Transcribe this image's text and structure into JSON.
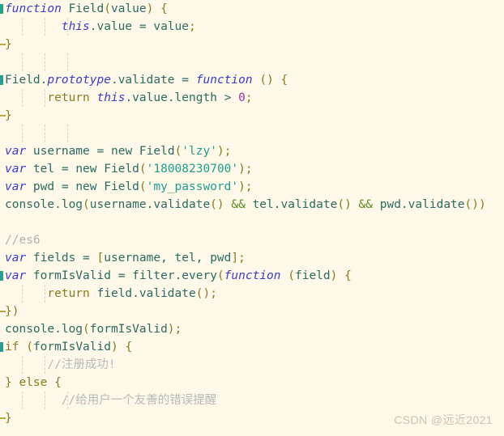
{
  "editor": {
    "background_color": "#fdf8e7",
    "language": "javascript",
    "colors": {
      "keyword": "#3b3bcd",
      "control": "#8a7a1e",
      "identifier": "#2b6b63",
      "string": "#1e9e8f",
      "number": "#9b30b0",
      "comment": "#b0b0b0",
      "punctuation": "#8a7a1e",
      "fold_marker": "#2a9d8f"
    }
  },
  "watermark": {
    "text": "CSDN @远近2021"
  },
  "code": {
    "lines": [
      {
        "id": "line-1",
        "fold": "start",
        "guides": [],
        "text": "function Field(value) {",
        "tokens": [
          {
            "t": "function",
            "c": "kw"
          },
          {
            "t": " ",
            "c": "plain"
          },
          {
            "t": "Field",
            "c": "ident"
          },
          {
            "t": "(",
            "c": "punc"
          },
          {
            "t": "value",
            "c": "ident"
          },
          {
            "t": ")",
            "c": "punc"
          },
          {
            "t": " ",
            "c": "plain"
          },
          {
            "t": "{",
            "c": "punc"
          }
        ]
      },
      {
        "id": "line-2",
        "fold": "none",
        "guides": [
          27,
          55,
          83
        ],
        "text": "        this.value = value;",
        "tokens": [
          {
            "t": "        ",
            "c": "plain"
          },
          {
            "t": "this",
            "c": "kw"
          },
          {
            "t": ".value ",
            "c": "ident"
          },
          {
            "t": "=",
            "c": "op"
          },
          {
            "t": " value",
            "c": "ident"
          },
          {
            "t": ";",
            "c": "punc"
          }
        ]
      },
      {
        "id": "line-3",
        "fold": "end",
        "guides": [],
        "text": "}",
        "tokens": [
          {
            "t": "}",
            "c": "punc"
          }
        ]
      },
      {
        "id": "line-4",
        "fold": "none",
        "guides": [
          27,
          55,
          83
        ],
        "text": "",
        "tokens": []
      },
      {
        "id": "line-5",
        "fold": "start",
        "guides": [],
        "text": "Field.prototype.validate = function () {",
        "tokens": [
          {
            "t": "Field",
            "c": "ident"
          },
          {
            "t": ".",
            "c": "plain"
          },
          {
            "t": "prototype",
            "c": "kw"
          },
          {
            "t": ".validate ",
            "c": "ident"
          },
          {
            "t": "=",
            "c": "op"
          },
          {
            "t": " ",
            "c": "plain"
          },
          {
            "t": "function",
            "c": "kw"
          },
          {
            "t": " ",
            "c": "plain"
          },
          {
            "t": "(",
            "c": "punc"
          },
          {
            "t": ")",
            "c": "punc"
          },
          {
            "t": " ",
            "c": "plain"
          },
          {
            "t": "{",
            "c": "punc"
          }
        ]
      },
      {
        "id": "line-6",
        "fold": "none",
        "guides": [
          27,
          55
        ],
        "text": "      return this.value.length > 0;",
        "tokens": [
          {
            "t": "      ",
            "c": "plain"
          },
          {
            "t": "return",
            "c": "ctrl"
          },
          {
            "t": " ",
            "c": "plain"
          },
          {
            "t": "this",
            "c": "kw"
          },
          {
            "t": ".value.length ",
            "c": "ident"
          },
          {
            "t": ">",
            "c": "op"
          },
          {
            "t": " ",
            "c": "plain"
          },
          {
            "t": "0",
            "c": "num"
          },
          {
            "t": ";",
            "c": "punc"
          }
        ]
      },
      {
        "id": "line-7",
        "fold": "end",
        "guides": [],
        "text": "}",
        "tokens": [
          {
            "t": "}",
            "c": "punc"
          }
        ]
      },
      {
        "id": "line-8",
        "fold": "none",
        "guides": [
          27,
          55,
          83
        ],
        "text": "",
        "tokens": []
      },
      {
        "id": "line-9",
        "fold": "none",
        "guides": [],
        "text": "var username = new Field('lzy');",
        "tokens": [
          {
            "t": "var",
            "c": "kw"
          },
          {
            "t": " username ",
            "c": "ident"
          },
          {
            "t": "=",
            "c": "op"
          },
          {
            "t": " new ",
            "c": "ident"
          },
          {
            "t": "Field",
            "c": "ident"
          },
          {
            "t": "(",
            "c": "punc"
          },
          {
            "t": "'lzy'",
            "c": "str"
          },
          {
            "t": ")",
            "c": "punc"
          },
          {
            "t": ";",
            "c": "punc"
          }
        ]
      },
      {
        "id": "line-10",
        "fold": "none",
        "guides": [],
        "text": "var tel = new Field('18008230700');",
        "tokens": [
          {
            "t": "var",
            "c": "kw"
          },
          {
            "t": " tel ",
            "c": "ident"
          },
          {
            "t": "=",
            "c": "op"
          },
          {
            "t": " new ",
            "c": "ident"
          },
          {
            "t": "Field",
            "c": "ident"
          },
          {
            "t": "(",
            "c": "punc"
          },
          {
            "t": "'18008230700'",
            "c": "str"
          },
          {
            "t": ")",
            "c": "punc"
          },
          {
            "t": ";",
            "c": "punc"
          }
        ]
      },
      {
        "id": "line-11",
        "fold": "none",
        "guides": [],
        "text": "var pwd = new Field('my_password');",
        "tokens": [
          {
            "t": "var",
            "c": "kw"
          },
          {
            "t": " pwd ",
            "c": "ident"
          },
          {
            "t": "=",
            "c": "op"
          },
          {
            "t": " new ",
            "c": "ident"
          },
          {
            "t": "Field",
            "c": "ident"
          },
          {
            "t": "(",
            "c": "punc"
          },
          {
            "t": "'my_password'",
            "c": "str"
          },
          {
            "t": ")",
            "c": "punc"
          },
          {
            "t": ";",
            "c": "punc"
          }
        ]
      },
      {
        "id": "line-12",
        "fold": "none",
        "guides": [],
        "text": "console.log(username.validate() && tel.validate() && pwd.validate())",
        "tokens": [
          {
            "t": "console.log",
            "c": "ident"
          },
          {
            "t": "(",
            "c": "punc"
          },
          {
            "t": "username.validate",
            "c": "ident"
          },
          {
            "t": "()",
            "c": "punc"
          },
          {
            "t": " ",
            "c": "plain"
          },
          {
            "t": "&&",
            "c": "amp"
          },
          {
            "t": " tel.validate",
            "c": "ident"
          },
          {
            "t": "()",
            "c": "punc"
          },
          {
            "t": " ",
            "c": "plain"
          },
          {
            "t": "&&",
            "c": "amp"
          },
          {
            "t": " pwd.validate",
            "c": "ident"
          },
          {
            "t": "())",
            "c": "punc"
          }
        ]
      },
      {
        "id": "line-13",
        "fold": "none",
        "guides": [],
        "text": "",
        "tokens": []
      },
      {
        "id": "line-14",
        "fold": "none",
        "guides": [],
        "text": "//es6",
        "tokens": [
          {
            "t": "//es6",
            "c": "cmt"
          }
        ]
      },
      {
        "id": "line-15",
        "fold": "none",
        "guides": [],
        "text": "var fields = [username, tel, pwd];",
        "tokens": [
          {
            "t": "var",
            "c": "kw"
          },
          {
            "t": " fields ",
            "c": "ident"
          },
          {
            "t": "=",
            "c": "op"
          },
          {
            "t": " ",
            "c": "plain"
          },
          {
            "t": "[",
            "c": "punc"
          },
          {
            "t": "username, tel, pwd",
            "c": "ident"
          },
          {
            "t": "]",
            "c": "punc"
          },
          {
            "t": ";",
            "c": "punc"
          }
        ]
      },
      {
        "id": "line-16",
        "fold": "start",
        "guides": [],
        "text": "var formIsValid = filter.every(function (field) {",
        "tokens": [
          {
            "t": "var",
            "c": "kw"
          },
          {
            "t": " formIsValid ",
            "c": "ident"
          },
          {
            "t": "=",
            "c": "op"
          },
          {
            "t": " filter.every",
            "c": "ident"
          },
          {
            "t": "(",
            "c": "punc"
          },
          {
            "t": "function",
            "c": "kw"
          },
          {
            "t": " ",
            "c": "plain"
          },
          {
            "t": "(",
            "c": "punc"
          },
          {
            "t": "field",
            "c": "ident"
          },
          {
            "t": ")",
            "c": "punc"
          },
          {
            "t": " ",
            "c": "plain"
          },
          {
            "t": "{",
            "c": "punc"
          }
        ]
      },
      {
        "id": "line-17",
        "fold": "none",
        "guides": [
          27,
          55
        ],
        "text": "      return field.validate();",
        "tokens": [
          {
            "t": "      ",
            "c": "plain"
          },
          {
            "t": "return",
            "c": "ctrl"
          },
          {
            "t": " field.validate",
            "c": "ident"
          },
          {
            "t": "()",
            "c": "punc"
          },
          {
            "t": ";",
            "c": "punc"
          }
        ]
      },
      {
        "id": "line-18",
        "fold": "end",
        "guides": [],
        "text": "})",
        "tokens": [
          {
            "t": "})",
            "c": "punc"
          }
        ]
      },
      {
        "id": "line-19",
        "fold": "none",
        "guides": [],
        "text": "console.log(formIsValid);",
        "tokens": [
          {
            "t": "console.log",
            "c": "ident"
          },
          {
            "t": "(",
            "c": "punc"
          },
          {
            "t": "formIsValid",
            "c": "ident"
          },
          {
            "t": ")",
            "c": "punc"
          },
          {
            "t": ";",
            "c": "punc"
          }
        ]
      },
      {
        "id": "line-20",
        "fold": "start",
        "guides": [],
        "text": "if (formIsValid) {",
        "tokens": [
          {
            "t": "if",
            "c": "ctrl"
          },
          {
            "t": " ",
            "c": "plain"
          },
          {
            "t": "(",
            "c": "punc"
          },
          {
            "t": "formIsValid",
            "c": "ident"
          },
          {
            "t": ")",
            "c": "punc"
          },
          {
            "t": " ",
            "c": "plain"
          },
          {
            "t": "{",
            "c": "punc"
          }
        ]
      },
      {
        "id": "line-21",
        "fold": "none",
        "guides": [
          27,
          55
        ],
        "text": "      //注册成功!",
        "tokens": [
          {
            "t": "      ",
            "c": "plain"
          },
          {
            "t": "//注册成功!",
            "c": "cmt-cn"
          }
        ]
      },
      {
        "id": "line-22",
        "fold": "none",
        "guides": [],
        "text": "} else {",
        "tokens": [
          {
            "t": "}",
            "c": "punc"
          },
          {
            "t": " ",
            "c": "plain"
          },
          {
            "t": "else",
            "c": "ctrl"
          },
          {
            "t": " ",
            "c": "plain"
          },
          {
            "t": "{",
            "c": "punc"
          }
        ]
      },
      {
        "id": "line-23",
        "fold": "none",
        "guides": [
          27,
          55,
          83
        ],
        "text": "        //给用户一个友善的错误提醒",
        "tokens": [
          {
            "t": "        ",
            "c": "plain"
          },
          {
            "t": "//给用户一个友善的错误提醒",
            "c": "cmt-cn"
          }
        ]
      },
      {
        "id": "line-24",
        "fold": "end",
        "guides": [],
        "text": "}",
        "tokens": [
          {
            "t": "}",
            "c": "punc"
          }
        ]
      }
    ]
  }
}
